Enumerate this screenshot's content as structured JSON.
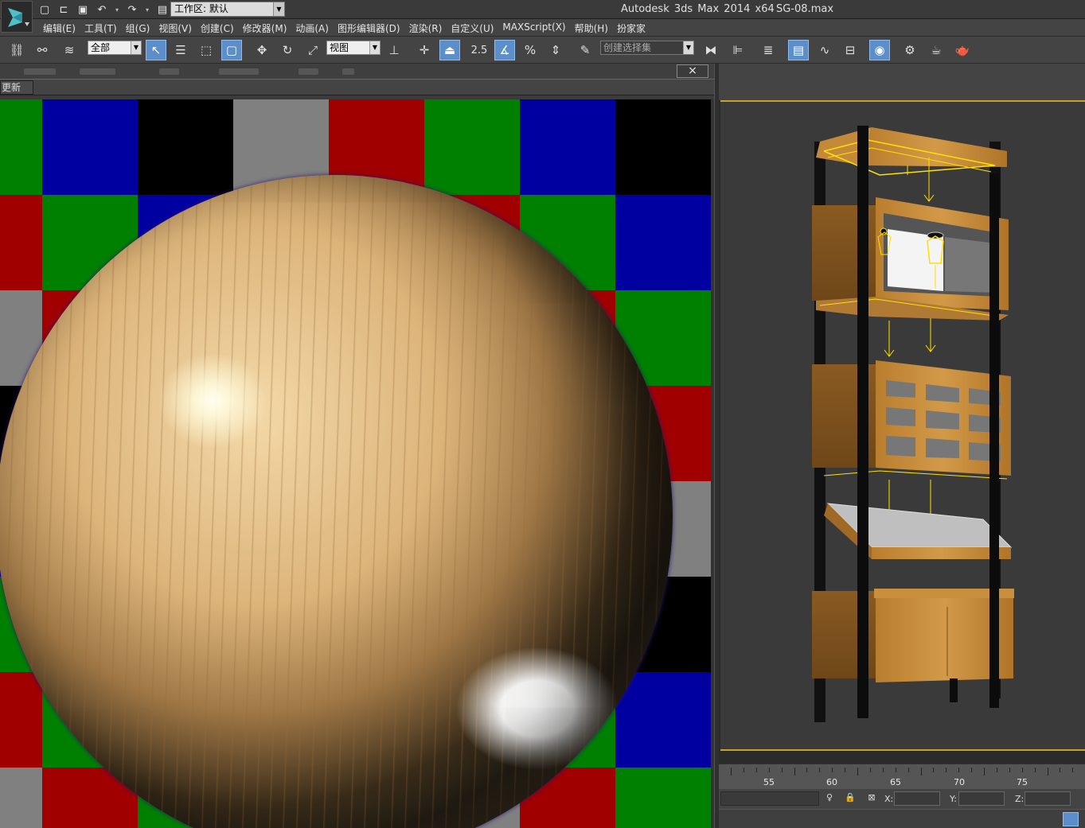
{
  "title_bar": {
    "workspace_label": "工作区: 默认",
    "app_title": "Autodesk 3ds Max  2014 x64",
    "file_name": "SG-08.max"
  },
  "menu": [
    "编辑(E)",
    "工具(T)",
    "组(G)",
    "视图(V)",
    "创建(C)",
    "修改器(M)",
    "动画(A)",
    "图形编辑器(D)",
    "渲染(R)",
    "自定义(U)",
    "MAXScript(X)",
    "帮助(H)",
    "扮家家"
  ],
  "toolbar": {
    "filter_value": "全部",
    "coord_value": "视图",
    "snap_label": "2.5",
    "percent_label": "%",
    "selection_set_placeholder": "创建选择集"
  },
  "material_window": {
    "close_label": "×",
    "update_label": "更新"
  },
  "timeline": {
    "labels": [
      "55",
      "60",
      "65",
      "70",
      "75"
    ]
  },
  "status": {
    "x_label": "X:",
    "y_label": "Y:",
    "z_label": "Z:"
  },
  "icons": {
    "logo": "3ds-max-logo-icon",
    "new": "new-file-icon",
    "open": "open-file-icon",
    "save": "save-icon",
    "undo": "undo-icon",
    "redo": "redo-icon",
    "project": "project-folder-icon"
  },
  "colors": {
    "accent": "#5c8fc9",
    "viewport_border": "#c9a227",
    "wood": "#c8903c"
  }
}
